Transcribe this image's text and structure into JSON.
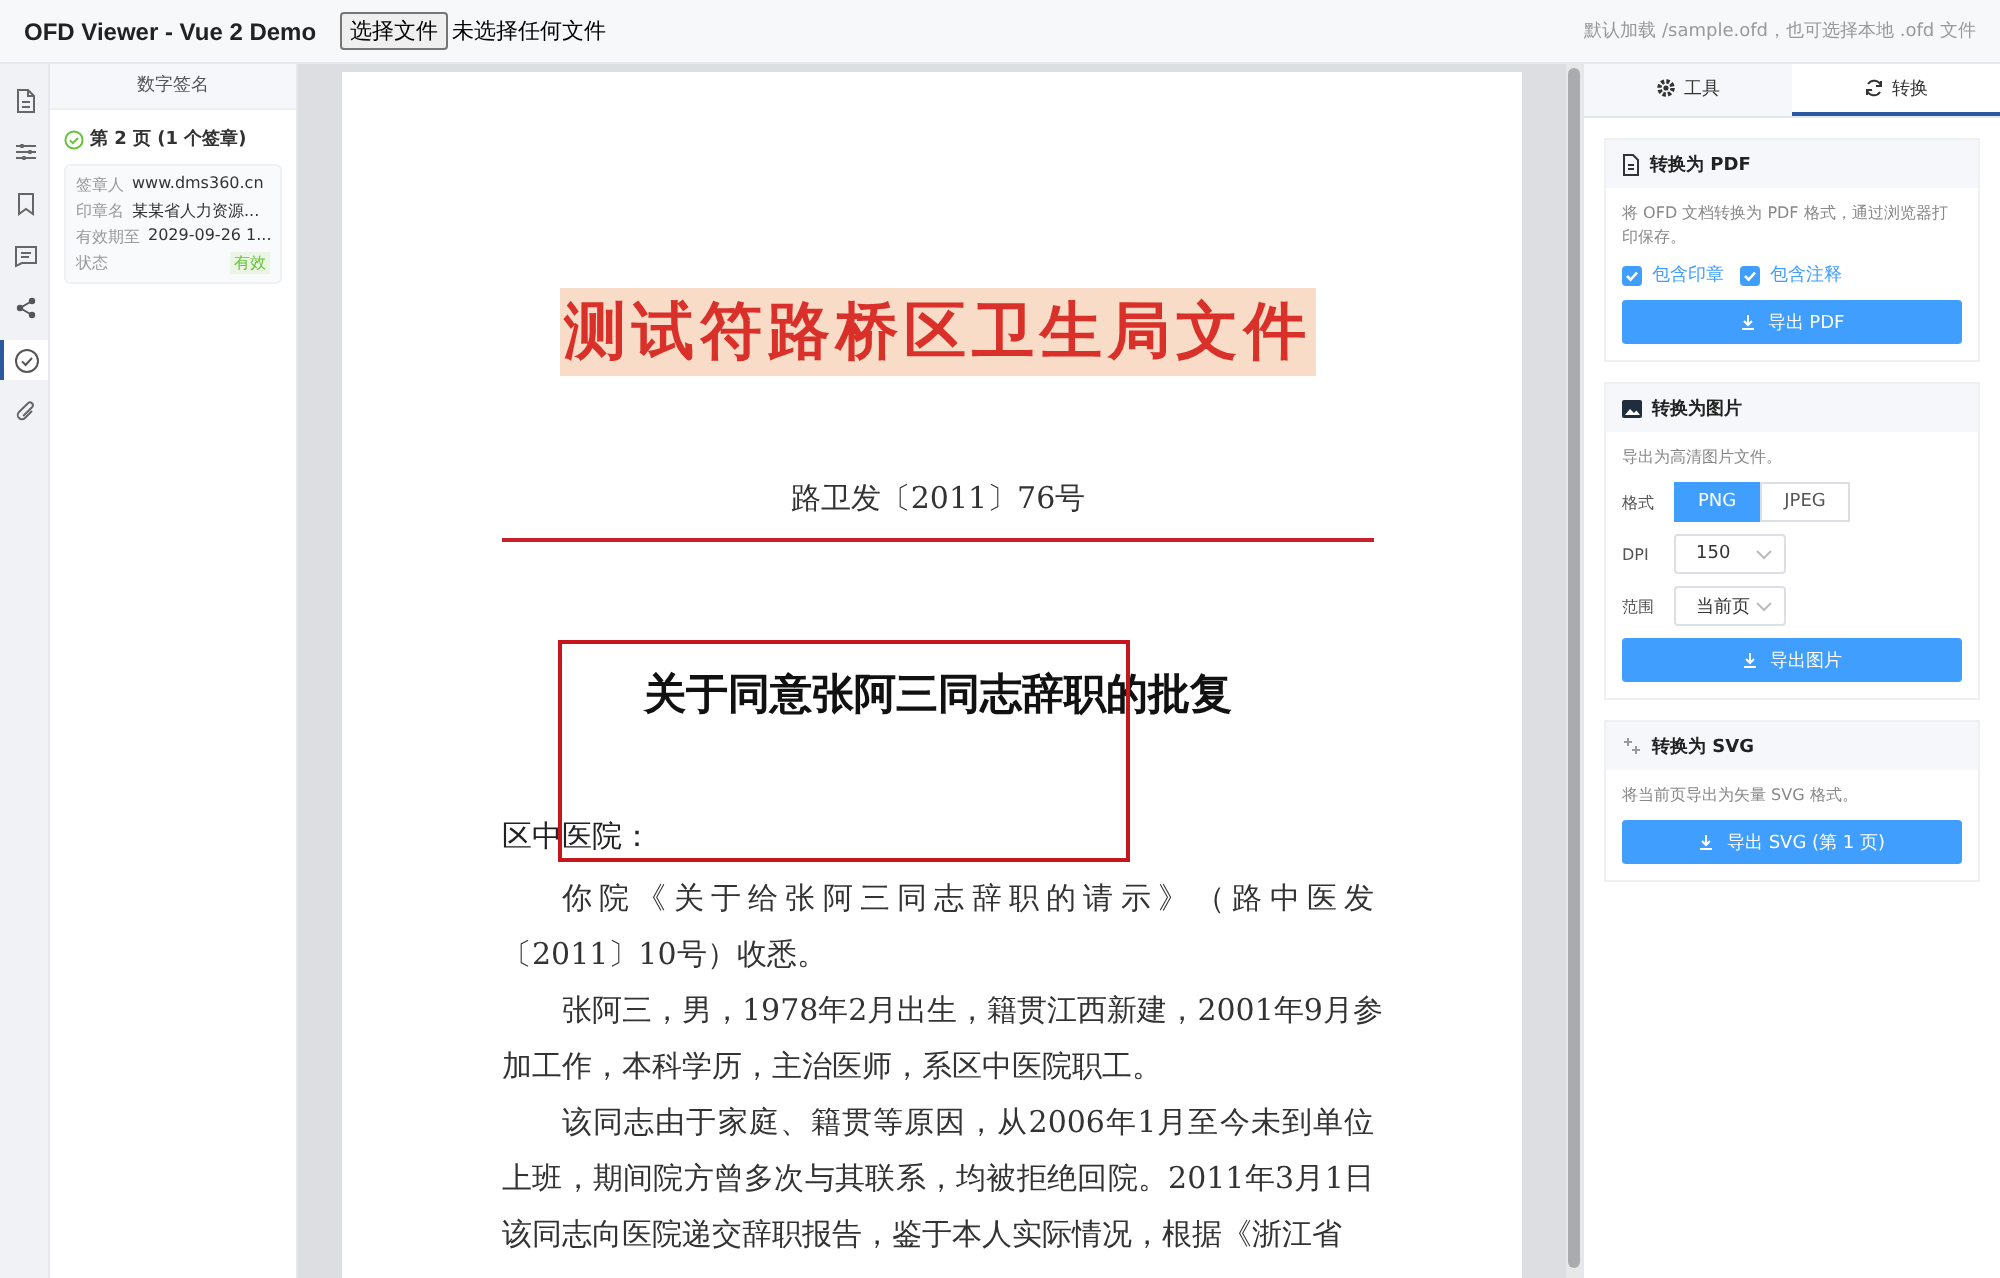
{
  "header": {
    "title": "OFD Viewer - Vue 2 Demo",
    "file_button": "选择文件",
    "file_status": "未选择任何文件",
    "hint": "默认加载 /sample.ofd，也可选择本地 .ofd 文件"
  },
  "rail": [
    {
      "kind": "document",
      "selected": false
    },
    {
      "kind": "sliders",
      "selected": false
    },
    {
      "kind": "bookmark",
      "selected": false
    },
    {
      "kind": "comment",
      "selected": false
    },
    {
      "kind": "share",
      "selected": false
    },
    {
      "kind": "check",
      "selected": true
    },
    {
      "kind": "attachment",
      "selected": false
    }
  ],
  "sidebar": {
    "title": "数字签名",
    "group": {
      "label": "第 2 页 (1 个签章)",
      "rows": [
        {
          "label": "签章人",
          "value": "www.dms360.cn"
        },
        {
          "label": "印章名",
          "value": "某某省人力资源..."
        },
        {
          "label": "有效期至",
          "value": "2029-09-26 1..."
        }
      ],
      "status_label": "状态",
      "status": "有效",
      "valid": true
    }
  },
  "document": {
    "title": "测试符路桥区卫生局文件",
    "doc_number": "路卫发〔2011〕76号",
    "heading": "关于同意张阿三同志辞职的批复",
    "salutation": "区中医院：",
    "paragraphs": [
      {
        "lines": [
          "你院《关于给张阿三同志辞职的请示》（路中医发",
          "〔2011〕10号）收悉。"
        ]
      },
      {
        "lines": [
          "张阿三，男，1978年2月出生，籍贯江西新建，2001年9月参",
          "加工作，本科学历，主治医师，系区中医院职工。"
        ]
      },
      {
        "lines": [
          "该同志由于家庭、籍贯等原因，从2006年1月至今未到单位",
          "上班，期间院方曾多次与其联系，均被拒绝回院。2011年3月1日",
          "该同志向医院递交辞职报告，鉴于本人实际情况，根据《浙江省"
        ]
      }
    ]
  },
  "panel": {
    "tabs": [
      {
        "label": "工具",
        "kind": "gear",
        "selected": false
      },
      {
        "label": "转换",
        "kind": "refresh",
        "selected": true
      }
    ],
    "sections": [
      {
        "kind": "document",
        "title": "转换为 PDF",
        "description": "将 OFD 文档转换为 PDF 格式，通过浏览器打印保存。",
        "checkboxes": [
          {
            "label": "包含印章",
            "checked": true
          },
          {
            "label": "包含注释",
            "checked": true
          }
        ],
        "button": "导出 PDF"
      },
      {
        "kind": "image",
        "title": "转换为图片",
        "description": "导出为高清图片文件。",
        "format": {
          "label": "格式",
          "options": [
            {
              "label": "PNG",
              "selected": true
            },
            {
              "label": "JPEG",
              "selected": false
            }
          ]
        },
        "selects": [
          {
            "label": "DPI",
            "value": "150"
          },
          {
            "label": "范围",
            "value": "当前页"
          }
        ],
        "button": "导出图片"
      },
      {
        "kind": "sparkle",
        "title": "转换为 SVG",
        "description": "将当前页导出为矢量 SVG 格式。",
        "button": "导出 SVG (第 1 页)"
      }
    ]
  }
}
